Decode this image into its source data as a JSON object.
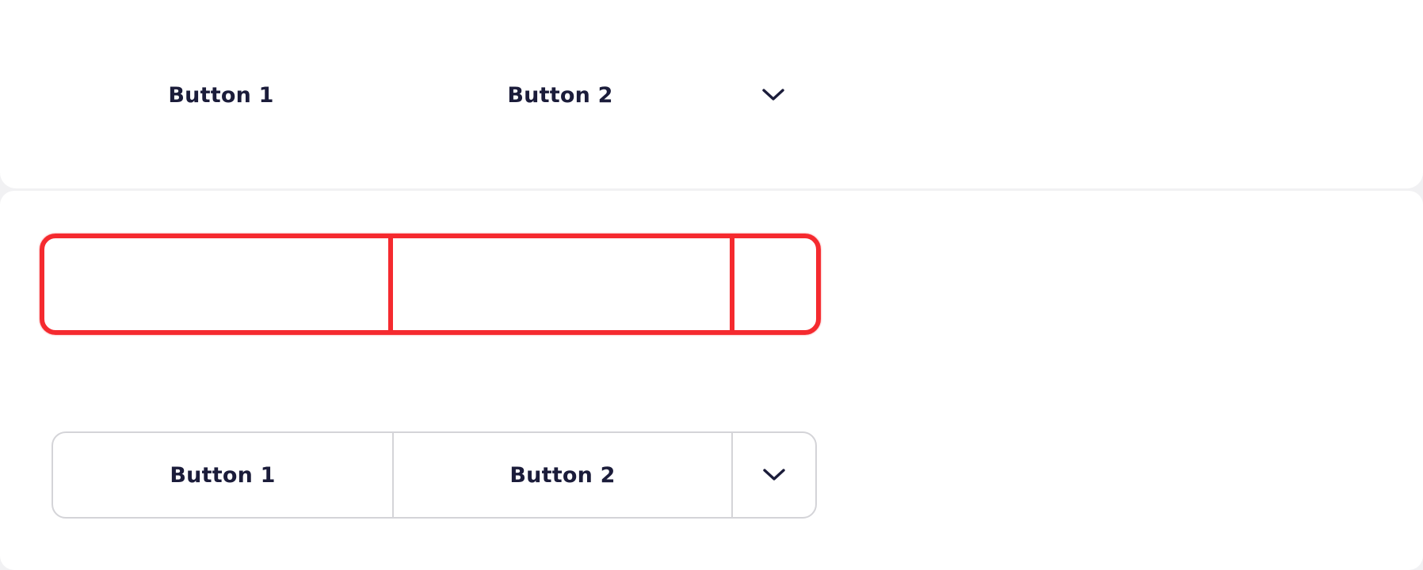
{
  "rows": {
    "plain": {
      "button1_label": "Button 1",
      "button2_label": "Button 2",
      "dropdown_icon": "chevron-down-icon"
    },
    "outlined": {
      "button1_label": "Button 1",
      "button2_label": "Button 2",
      "dropdown_icon": "chevron-down-icon"
    }
  },
  "colors": {
    "text": "#1b1c3a",
    "highlight_outline": "#f52a2f",
    "border": "#d4d4d8",
    "background": "#ffffff"
  }
}
